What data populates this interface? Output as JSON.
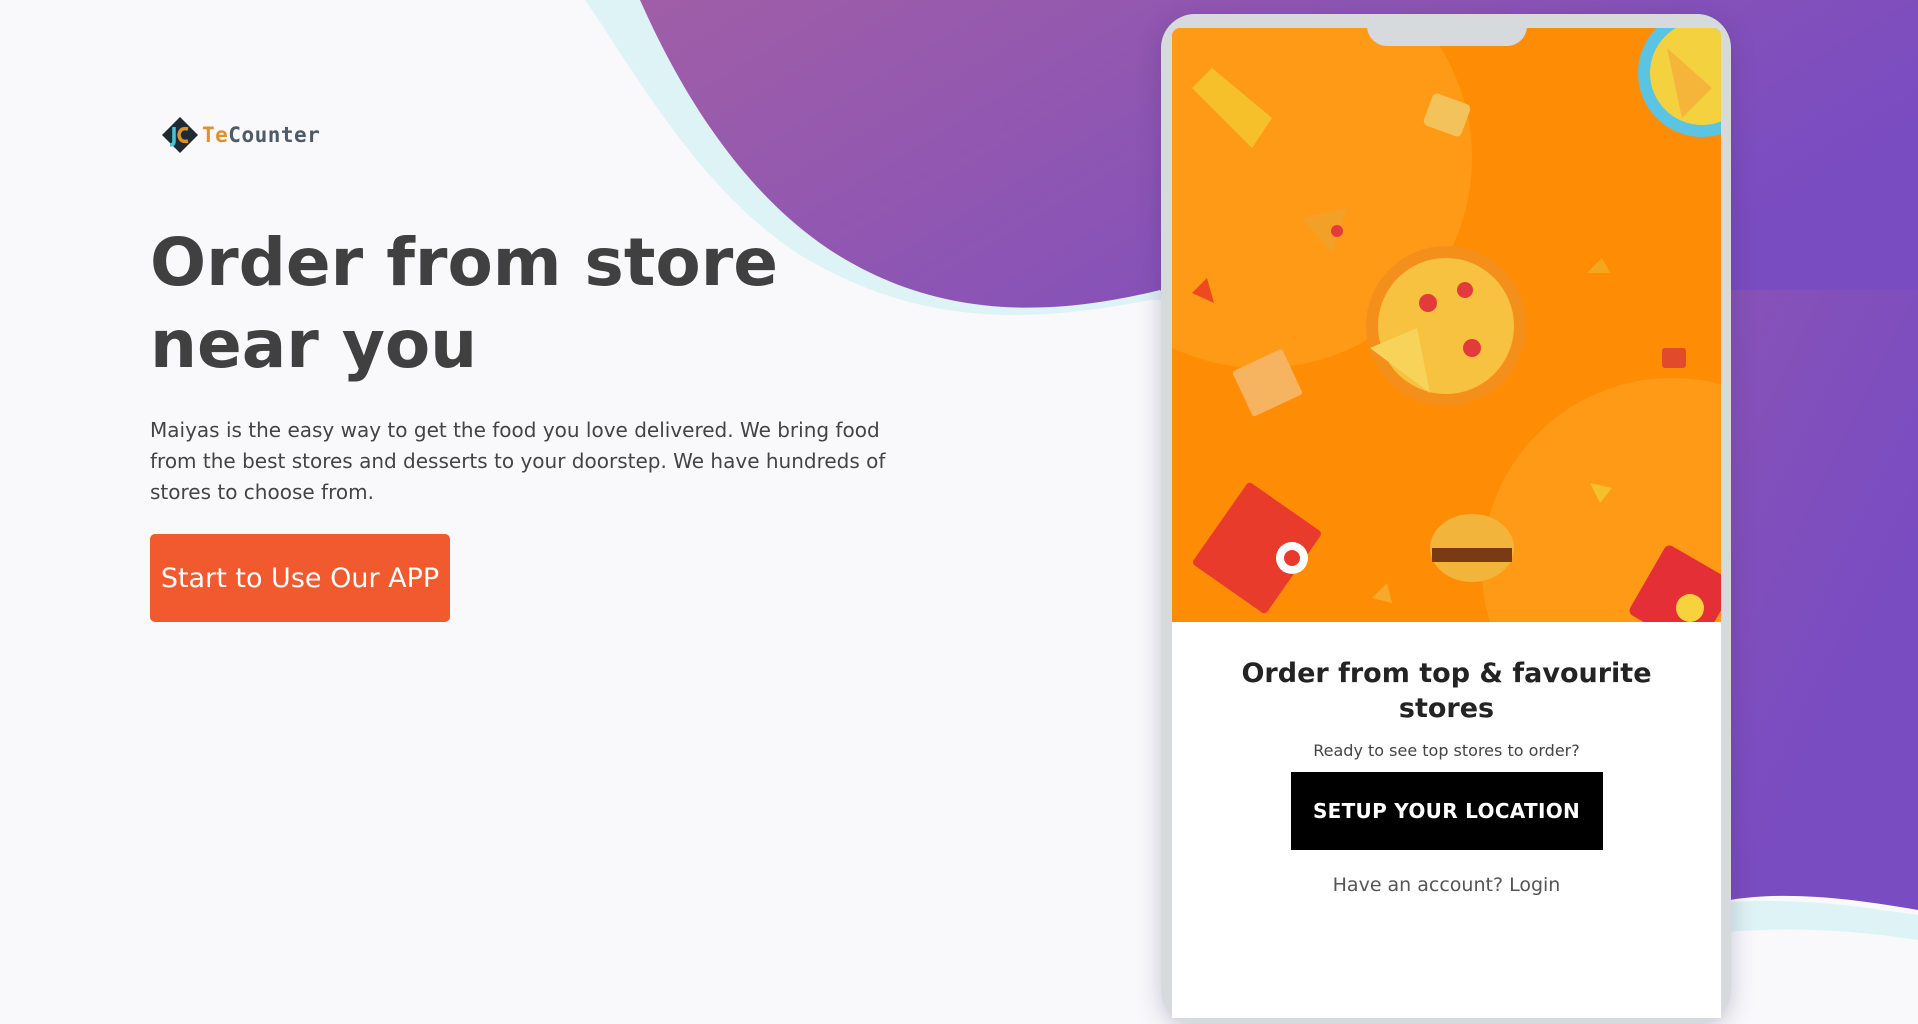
{
  "brand": {
    "logo_text_first": "Te",
    "logo_text_rest": "Counter"
  },
  "hero": {
    "title": "Order from store near you",
    "description": "Maiyas is the easy way to get the food you love delivered. We bring food from the best stores and desserts to your doorstep. We have hundreds of stores to choose from.",
    "cta_label": "Start to Use Our APP"
  },
  "phone_screen": {
    "title": "Order from top & favourite stores",
    "subtitle": "Ready to see top stores to order?",
    "setup_button": "SETUP YOUR LOCATION",
    "login_prompt": "Have an account?",
    "login_link": "Login"
  },
  "colors": {
    "accent": "#f05a2e",
    "purple_start": "#9c5ca8",
    "purple_end": "#7b4cc0",
    "orange_bg": "#ff8c05",
    "heading": "#404040"
  }
}
